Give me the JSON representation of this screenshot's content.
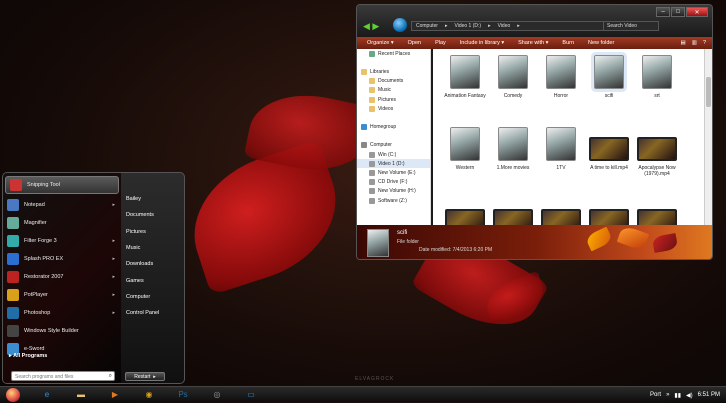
{
  "desktop": {
    "watermark": "ELVAGROCK"
  },
  "start_menu": {
    "pinned": [
      {
        "label": "Snipping Tool",
        "icon": "scissors-icon",
        "color": "#c33",
        "arrow": false
      },
      {
        "label": "Notepad",
        "icon": "notepad-icon",
        "color": "#4a79c4",
        "arrow": true
      },
      {
        "label": "Magnifier",
        "icon": "magnifier-icon",
        "color": "#6a9",
        "arrow": false
      },
      {
        "label": "Filter Forge 3",
        "icon": "filterforge-icon",
        "color": "#3aa",
        "arrow": true
      },
      {
        "label": "Splash PRO EX",
        "icon": "splash-icon",
        "color": "#2b6fd3",
        "arrow": true
      },
      {
        "label": "Restorator 2007",
        "icon": "restorator-icon",
        "color": "#b22",
        "arrow": true
      },
      {
        "label": "PotPlayer",
        "icon": "potplayer-icon",
        "color": "#d9a11a",
        "arrow": true
      },
      {
        "label": "Photoshop",
        "icon": "photoshop-icon",
        "color": "#1f6ea8",
        "arrow": true
      },
      {
        "label": "Windows Style Builder",
        "icon": "stylebuilder-icon",
        "color": "#444",
        "arrow": false
      },
      {
        "label": "e-Sword",
        "icon": "esword-icon",
        "color": "#3a8ecf",
        "arrow": false
      }
    ],
    "all_programs": "All Programs",
    "search_placeholder": "Search programs and files",
    "right_links": [
      "Bailey",
      "Documents",
      "Pictures",
      "Music",
      "Downloads",
      "Games",
      "Computer",
      "Control Panel"
    ],
    "restart_label": "Restart",
    "restart_arrow": "▸"
  },
  "explorer": {
    "address": [
      "Computer",
      "Video 1 (D:)",
      "Video"
    ],
    "search_placeholder": "Search Video",
    "toolbar": [
      "Organize ▾",
      "Open",
      "Play",
      "Include in library ▾",
      "Share with ▾",
      "Burn",
      "New folder"
    ],
    "nav_items": [
      {
        "label": "Recent Places",
        "indent": 1,
        "color": "#6a8"
      },
      {
        "label": "",
        "indent": 0,
        "color": ""
      },
      {
        "label": "Libraries",
        "indent": 0,
        "color": "#e9c26c"
      },
      {
        "label": "Documents",
        "indent": 1,
        "color": "#e9c26c"
      },
      {
        "label": "Music",
        "indent": 1,
        "color": "#e9c26c"
      },
      {
        "label": "Pictures",
        "indent": 1,
        "color": "#e9c26c"
      },
      {
        "label": "Videos",
        "indent": 1,
        "color": "#e9c26c"
      },
      {
        "label": "",
        "indent": 0,
        "color": ""
      },
      {
        "label": "Homegroup",
        "indent": 0,
        "color": "#3a8ecf"
      },
      {
        "label": "",
        "indent": 0,
        "color": ""
      },
      {
        "label": "Computer",
        "indent": 0,
        "color": "#888"
      },
      {
        "label": "Win (C:)",
        "indent": 1,
        "color": "#999"
      },
      {
        "label": "Video 1 (D:)",
        "indent": 1,
        "color": "#999",
        "selected": true
      },
      {
        "label": "New Volume (E:)",
        "indent": 1,
        "color": "#999"
      },
      {
        "label": "CD Drive (F:)",
        "indent": 1,
        "color": "#999"
      },
      {
        "label": "New Volume (H:)",
        "indent": 1,
        "color": "#999"
      },
      {
        "label": "Software (Z:)",
        "indent": 1,
        "color": "#999"
      }
    ],
    "items": [
      {
        "label": "Animation Fantasy",
        "kind": "folder"
      },
      {
        "label": "Comedy",
        "kind": "folder"
      },
      {
        "label": "Horror",
        "kind": "folder"
      },
      {
        "label": "scifi",
        "kind": "folder",
        "selected": true
      },
      {
        "label": "srt",
        "kind": "folder"
      },
      {
        "label": "Western",
        "kind": "folder"
      },
      {
        "label": "1.More movies",
        "kind": "folder"
      },
      {
        "label": "1TV",
        "kind": "folder"
      },
      {
        "label": "A time to kill.mp4",
        "kind": "video"
      },
      {
        "label": "Apocalypse Now (1979).mp4",
        "kind": "video"
      },
      {
        "label": "",
        "kind": "video"
      },
      {
        "label": "",
        "kind": "video"
      },
      {
        "label": "",
        "kind": "video"
      },
      {
        "label": "",
        "kind": "video"
      },
      {
        "label": "",
        "kind": "video"
      }
    ],
    "details": {
      "name": "scifi",
      "type": "File folder",
      "date_label": "Date modified:",
      "date_value": "7/4/2013 6:20 PM"
    }
  },
  "taskbar": {
    "apps": [
      {
        "name": "ie-icon",
        "glyph": "e",
        "color": "#3a8ecf"
      },
      {
        "name": "folder-icon",
        "glyph": "▬",
        "color": "#e9c26c"
      },
      {
        "name": "media-player-icon",
        "glyph": "▶",
        "color": "#e07a20"
      },
      {
        "name": "chrome-icon",
        "glyph": "◉",
        "color": "#d9a11a"
      },
      {
        "name": "photoshop-icon",
        "glyph": "Ps",
        "color": "#1f6ea8"
      },
      {
        "name": "settings-icon",
        "glyph": "◎",
        "color": "#999"
      },
      {
        "name": "explorer-icon",
        "glyph": "▭",
        "color": "#3a8ecf"
      }
    ],
    "port_label": "Port",
    "time": "6:51 PM"
  }
}
